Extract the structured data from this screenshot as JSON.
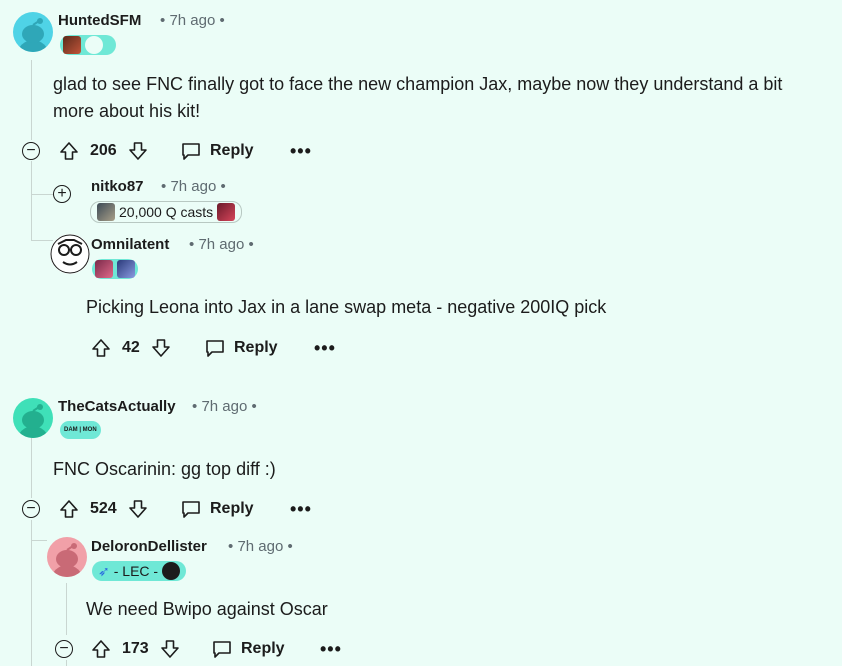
{
  "comments": [
    {
      "username": "HuntedSFM",
      "time": "7h ago",
      "body": "glad to see FNC finally got to face the new champion Jax, maybe now they understand a bit more about his kit!",
      "votes": "206",
      "reply": "Reply",
      "more": "•••"
    },
    {
      "username": "nitko87",
      "time": "7h ago",
      "flair": "20,000 Q casts"
    },
    {
      "username": "Omnilatent",
      "time": "7h ago",
      "body": "Picking Leona into Jax in a lane swap meta - negative 200IQ pick",
      "votes": "42",
      "reply": "Reply",
      "more": "•••"
    },
    {
      "username": "TheCatsActually",
      "time": "7h ago",
      "flair_small": "DAM | MON",
      "body": "FNC Oscarinin: gg top diff :)",
      "votes": "524",
      "reply": "Reply",
      "more": "•••"
    },
    {
      "username": "DeloronDellister",
      "time": "7h ago",
      "flair": "- LEC -",
      "body": "We need Bwipo against Oscar",
      "votes": "173",
      "reply": "Reply",
      "more": "•••"
    }
  ],
  "separator": "•",
  "colors": {
    "background": "#ebfdf7",
    "flair": "#6fe8d6",
    "thread_line": "#c9d6d1"
  }
}
